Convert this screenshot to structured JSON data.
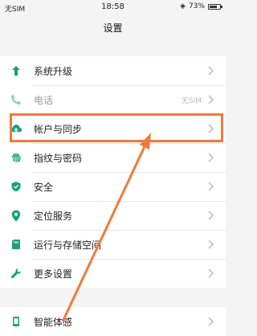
{
  "status_bar": {
    "carrier": "无SIM",
    "time": "18:58",
    "battery_text": "73%",
    "battery_level": 0.73
  },
  "page": {
    "title": "设置"
  },
  "settings": {
    "group1": [
      {
        "icon": "arrow-up-icon",
        "label": "系统升级",
        "sub": ""
      },
      {
        "icon": "phone-icon",
        "label": "电话",
        "sub": "无SIM"
      },
      {
        "icon": "cloud-user-icon",
        "label": "帐户与同步",
        "sub": ""
      },
      {
        "icon": "fingerprint-icon",
        "label": "指纹与密码",
        "sub": ""
      },
      {
        "icon": "shield-icon",
        "label": "安全",
        "sub": ""
      },
      {
        "icon": "location-pin-icon",
        "label": "定位服务",
        "sub": ""
      },
      {
        "icon": "storage-icon",
        "label": "运行与存储空间",
        "sub": ""
      },
      {
        "icon": "wrench-icon",
        "label": "更多设置",
        "sub": ""
      }
    ],
    "group2": [
      {
        "icon": "smart-icon",
        "label": "智能体感",
        "sub": ""
      }
    ]
  },
  "colors": {
    "accent_green": "#17a279",
    "phone_disabled": "#8fd0c1",
    "annotation": "#f17a3a"
  }
}
